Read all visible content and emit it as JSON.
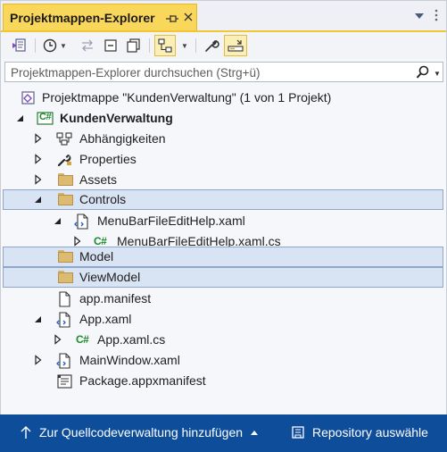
{
  "window": {
    "title": "Projektmappen-Explorer"
  },
  "search": {
    "placeholder": "Projektmappen-Explorer durchsuchen (Strg+ü)"
  },
  "tree": {
    "solution": "Projektmappe \"KundenVerwaltung\" (1 von 1 Projekt)",
    "project": "KundenVerwaltung",
    "project_badge": "C#",
    "dependencies": "Abhängigkeiten",
    "properties": "Properties",
    "assets": "Assets",
    "controls": "Controls",
    "menubar_xaml": "MenuBarFileEditHelp.xaml",
    "menubar_cs": "MenuBarFileEditHelp.xaml.cs",
    "model": "Model",
    "viewmodel": "ViewModel",
    "manifest": "app.manifest",
    "app_xaml": "App.xaml",
    "app_cs": "App.xaml.cs",
    "mainwindow": "MainWindow.xaml",
    "package": "Package.appxmanifest",
    "cs_badge": "C#"
  },
  "statusbar": {
    "left": "Zur Quellcodeverwaltung hinzufügen",
    "right": "Repository auswähle"
  },
  "colors": {
    "accent_tab": "#f9d75a",
    "selection": "#d8e3f3",
    "statusbar": "#0e4d9a",
    "csharp": "#1b8a2b"
  }
}
